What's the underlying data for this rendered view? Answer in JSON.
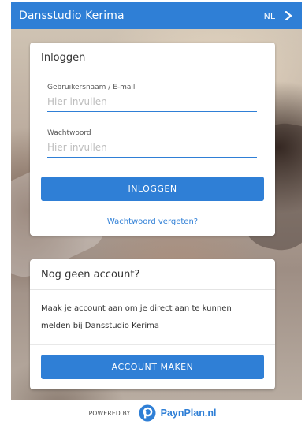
{
  "header": {
    "title": "Dansstudio Kerima",
    "language": "NL",
    "menu_icon": "chevron-right-icon"
  },
  "login": {
    "heading": "Inloggen",
    "username_label": "Gebruikersnaam / E-mail",
    "username_placeholder": "Hier invullen",
    "password_label": "Wachtwoord",
    "password_placeholder": "Hier invullen",
    "submit_label": "INLOGGEN",
    "forgot_link": "Wachtwoord vergeten?"
  },
  "signup": {
    "heading": "Nog geen account?",
    "description": "Maak je account aan om je direct aan te kunnen melden bij Dansstudio Kerima",
    "button_label": "ACCOUNT MAKEN"
  },
  "footer": {
    "powered_by": "POWERED BY",
    "brand": "PaynPlan.nl"
  },
  "colors": {
    "primary": "#2f7fd6",
    "card_bg": "#ffffff"
  }
}
